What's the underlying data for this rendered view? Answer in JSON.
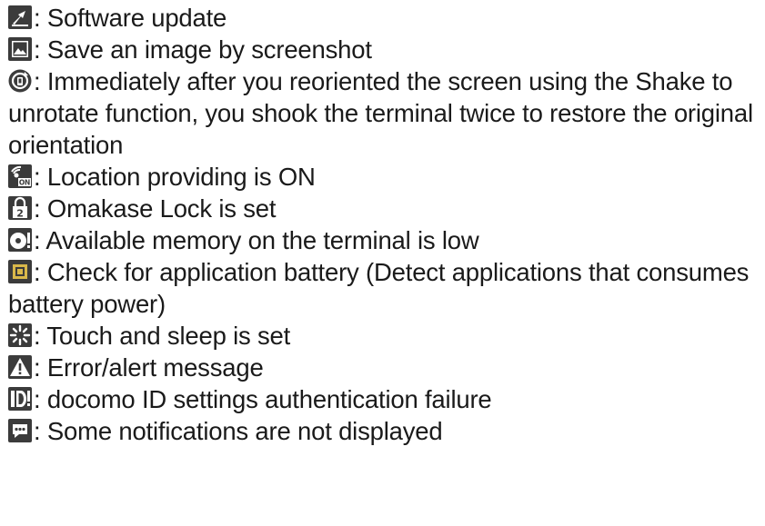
{
  "items": [
    {
      "icon": "software-update-icon",
      "text": ": Software update"
    },
    {
      "icon": "screenshot-image-icon",
      "text": ": Save an image by screenshot"
    },
    {
      "icon": "shake-rotate-icon",
      "text": ": Immediately after you reoriented the screen using the Shake to unrotate function, you shook the terminal twice to restore the original orientation"
    },
    {
      "icon": "location-on-icon",
      "text": ": Location providing is ON"
    },
    {
      "icon": "omakase-lock-icon",
      "text": ": Omakase Lock is set"
    },
    {
      "icon": "low-memory-icon",
      "text": ": Available memory on the terminal is low"
    },
    {
      "icon": "app-battery-check-icon",
      "text": ": Check for application battery (Detect applications that consumes battery power)"
    },
    {
      "icon": "touch-sleep-icon",
      "text": ": Touch and sleep is set"
    },
    {
      "icon": "alert-icon",
      "text": ": Error/alert message"
    },
    {
      "icon": "docomo-id-failure-icon",
      "text": ": docomo ID settings authentication failure"
    },
    {
      "icon": "more-notifications-icon",
      "text": ": Some notifications are not displayed"
    }
  ],
  "colors": {
    "icon_dark": "#3b3b3b",
    "icon_yellow": "#d9b84a",
    "text": "#1a1a1a"
  }
}
